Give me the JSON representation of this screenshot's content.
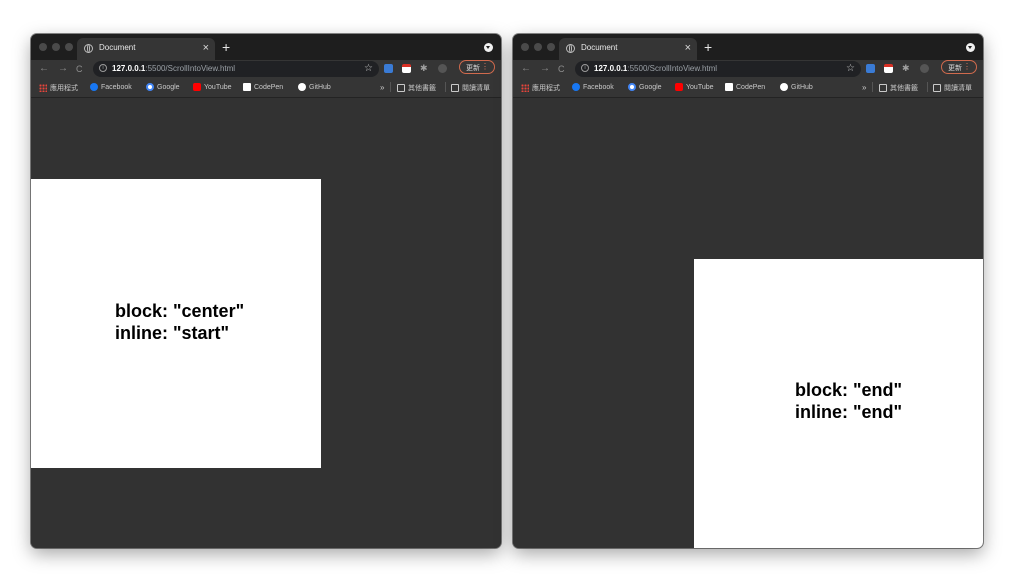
{
  "windows": [
    {
      "tab_title": "Document",
      "url_host": "127.0.0.1",
      "url_path": ":5500/ScrollIntoView.html",
      "update_label": "更新",
      "bookmarks": {
        "apps": "應用程式",
        "facebook": "Facebook",
        "google": "Google",
        "youtube": "YouTube",
        "codepen": "CodePen",
        "github": "GitHub",
        "more": "»",
        "other": "其他書籤",
        "reading_list": "閱讀清單"
      },
      "content": {
        "line1": "block: \"center\"",
        "line2": "inline: \"start\""
      }
    },
    {
      "tab_title": "Document",
      "url_host": "127.0.0.1",
      "url_path": ":5500/ScrollIntoView.html",
      "update_label": "更新",
      "bookmarks": {
        "apps": "應用程式",
        "facebook": "Facebook",
        "google": "Google",
        "youtube": "YouTube",
        "codepen": "CodePen",
        "github": "GitHub",
        "more": "»",
        "other": "其他書籤",
        "reading_list": "閱讀清單"
      },
      "content": {
        "line1": "block: \"end\"",
        "line2": "inline: \"end\""
      }
    }
  ],
  "icons": {
    "close": "×",
    "new_tab": "+",
    "back": "←",
    "forward": "→",
    "reload": "C",
    "star": "☆",
    "kebab": "⋮",
    "puzzle": "✱"
  }
}
